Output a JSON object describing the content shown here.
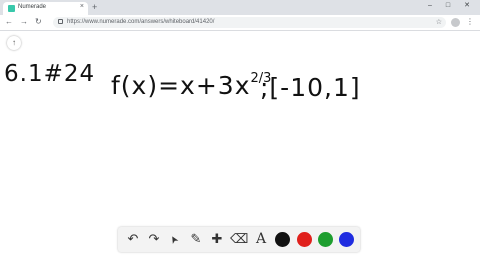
{
  "browser": {
    "tab_title": "Numerade",
    "tab_close": "×",
    "new_tab": "+",
    "url": "https://www.numerade.com/answers/whiteboard/41420/",
    "favicon_color": "#39c8ab"
  },
  "window_controls": {
    "minimize": "–",
    "maximize": "□",
    "close": "✕"
  },
  "nav": {
    "back": "←",
    "forward": "→",
    "reload": "↻",
    "star": "☆",
    "menu": "⋮"
  },
  "page": {
    "scroll_up": "↑",
    "problem_label": "6.1#24",
    "function_base": "f(x)=x+3x",
    "function_exponent": "2/3",
    "interval": ";[-10,1]"
  },
  "toolbar": {
    "undo": "↶",
    "redo": "↷",
    "pointer": "➤",
    "pencil": "✎",
    "add": "✚",
    "eraser": "⌫",
    "text": "A",
    "colors": [
      "#111111",
      "#e0201c",
      "#1e9e2f",
      "#1f2ce0"
    ]
  }
}
